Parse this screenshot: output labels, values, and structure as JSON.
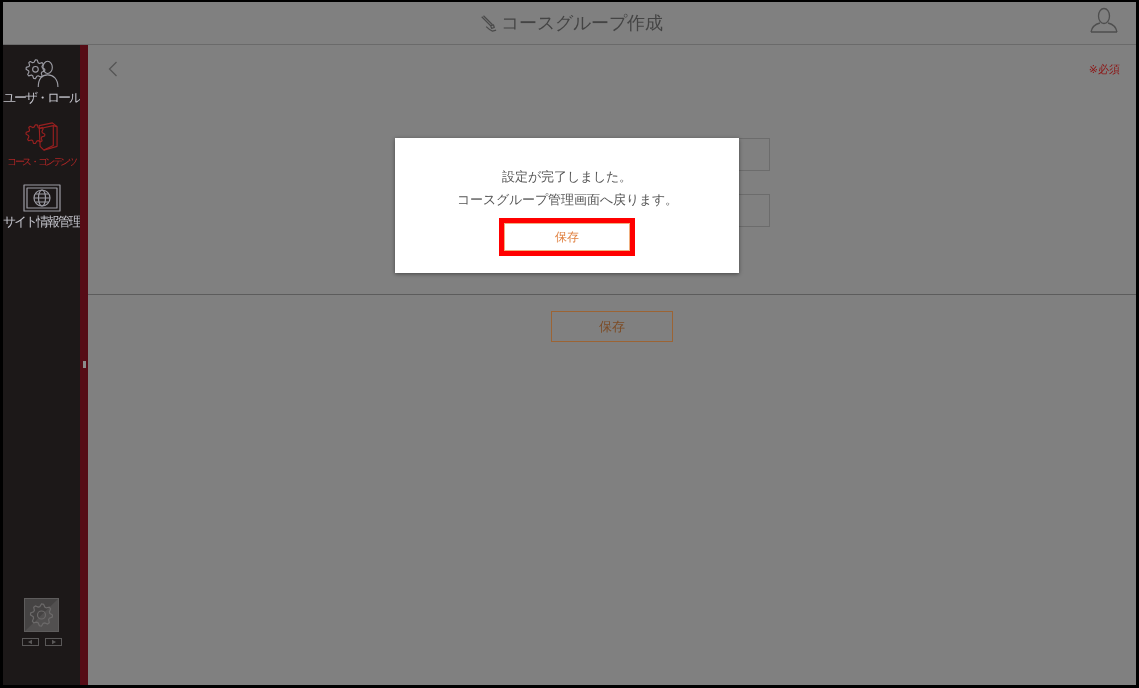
{
  "header": {
    "title": "コースグループ作成"
  },
  "sidebar": {
    "items": [
      {
        "label": "ユーザ・ロール",
        "selected": false
      },
      {
        "label": "コース・コンテンツ",
        "selected": true
      },
      {
        "label": "サイト情報管理",
        "selected": false
      }
    ]
  },
  "page": {
    "required_note": "※必須",
    "fields": [
      {
        "kind": "text"
      },
      {
        "kind": "text"
      }
    ],
    "save_button": "保存"
  },
  "dialog": {
    "message_lines": [
      "設定が完了しました。",
      "コースグループ管理画面へ戻ります。"
    ],
    "button": {
      "label": "保存",
      "highlighted": true
    }
  }
}
